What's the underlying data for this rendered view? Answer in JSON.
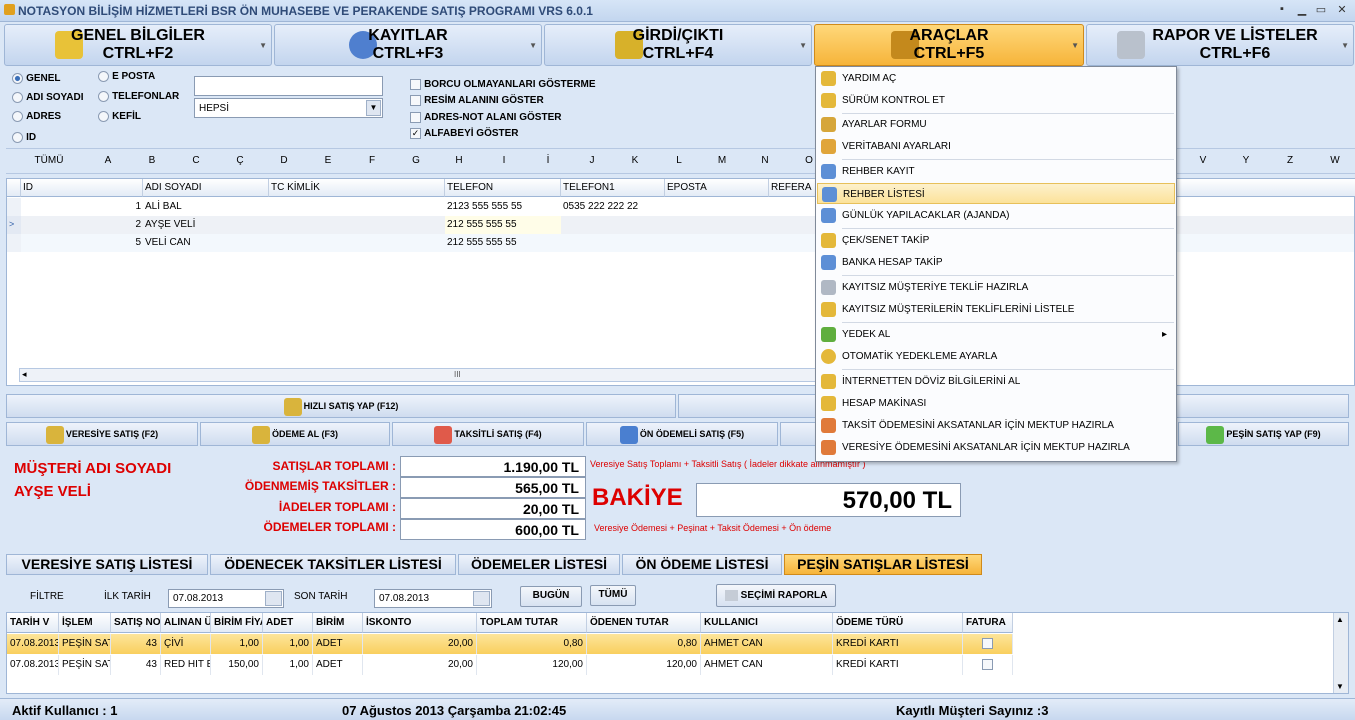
{
  "title": "NOTASYON BİLİŞİM HİZMETLERİ BSR ÖN MUHASEBE VE PERAKENDE SATIŞ PROGRAMI VRS 6.0.1",
  "window_buttons": [
    "▪",
    "▁",
    "▭",
    "✕"
  ],
  "top_menu": [
    {
      "line1": "GENEL BİLGİLER",
      "line2": "CTRL+F2",
      "icon": "notebook-icon"
    },
    {
      "line1": "KAYITLAR",
      "line2": "CTRL+F3",
      "icon": "users-icon"
    },
    {
      "line1": "GİRDİ/ÇIKTI",
      "line2": "CTRL+F4",
      "icon": "money-icon"
    },
    {
      "line1": "ARAÇLAR",
      "line2": "CTRL+F5",
      "icon": "truck-icon"
    },
    {
      "line1": "RAPOR VE LİSTELER",
      "line2": "CTRL+F6",
      "icon": "printer-icon"
    }
  ],
  "search": {
    "radios": [
      "GENEL",
      "ADI SOYADI",
      "ADRES",
      "ID",
      "E POSTA",
      "TELEFONLAR",
      "KEFİL"
    ],
    "text_value": "",
    "combo_value": "HEPSİ",
    "checks": [
      {
        "label": "BORCU OLMAYANLARI GÖSTERME",
        "checked": false
      },
      {
        "label": "RESİM ALANINI GÖSTER",
        "checked": false
      },
      {
        "label": "ADRES-NOT ALANI GÖSTER",
        "checked": false
      },
      {
        "label": "ALFABEYİ GÖSTER",
        "checked": true
      }
    ]
  },
  "alphabet": [
    "TÜMÜ",
    "A",
    "B",
    "C",
    "Ç",
    "D",
    "E",
    "F",
    "G",
    "H",
    "I",
    "İ",
    "J",
    "K",
    "L",
    "M",
    "N",
    "O",
    "V",
    "Y",
    "Z",
    "W"
  ],
  "customers": {
    "columns": [
      "ID",
      "ADI SOYADI",
      "TC KİMLİK",
      "TELEFON",
      "TELEFON1",
      "EPOSTA",
      "REFERA"
    ],
    "rows": [
      {
        "id": "1",
        "name": "ALİ BAL",
        "tc": "",
        "tel": "2123 555 555 55",
        "tel1": "0535 222 222 22",
        "mail": ""
      },
      {
        "id": "2",
        "name": "AYŞE VELİ",
        "tc": "",
        "tel": "212 555 555 55",
        "tel1": "",
        "mail": ""
      },
      {
        "id": "5",
        "name": "VELİ CAN",
        "tc": "",
        "tel": "212 555 555 55",
        "tel1": "",
        "mail": ""
      }
    ],
    "scroll_mark": "III"
  },
  "quick_sale": "HIZLI SATIŞ YAP  (F12)",
  "sale_buttons": [
    "VERESİYE SATIŞ  (F2)",
    "ÖDEME AL  (F3)",
    "TAKSİTLİ SATIŞ  (F4)",
    "ÖN ÖDEMELİ SATIŞ  (F5)",
    "PEŞİN SATIŞ YAP  (F9)"
  ],
  "customer": {
    "label": "MÜŞTERİ ADI SOYADI",
    "name": "AYŞE VELİ"
  },
  "totals": [
    {
      "label": "SATIŞLAR TOPLAMI :",
      "value": "1.190,00 TL"
    },
    {
      "label": "ÖDENMEMİŞ TAKSİTLER :",
      "value": "565,00 TL"
    },
    {
      "label": "İADELER TOPLAMI :",
      "value": "20,00 TL"
    },
    {
      "label": "ÖDEMELER TOPLAMI :",
      "value": "600,00 TL"
    }
  ],
  "note1": "Veresiye Satış Toplamı + Taksitli Satış ( İadeler dikkate alınmamıştır )",
  "note2": "Veresiye Ödemesi + Peşinat + Taksit Ödemesi + Ön ödeme",
  "balance": {
    "label": "BAKİYE",
    "value": "570,00 TL"
  },
  "list_tabs": [
    "VERESİYE SATIŞ LİSTESİ",
    "ÖDENECEK TAKSİTLER LİSTESİ",
    "ÖDEMELER LİSTESİ",
    "ÖN ÖDEME LİSTESİ",
    "PEŞİN SATIŞLAR LİSTESİ"
  ],
  "filter": {
    "label": "FİLTRE",
    "start_label": "İLK TARİH",
    "start": "07.08.2013",
    "end_label": "SON TARİH",
    "end": "07.08.2013",
    "today": "BUGÜN",
    "all": "TÜMÜ",
    "report": "SEÇİMİ RAPORLA"
  },
  "sales": {
    "columns": [
      "TARİH V",
      "İŞLEM",
      "SATIŞ NO",
      "ALINAN Ü",
      "BİRİM FİYAT",
      "ADET",
      "BİRİM",
      "İSKONTO",
      "TOPLAM TUTAR",
      "ÖDENEN TUTAR",
      "KULLANICI",
      "ÖDEME TÜRÜ",
      "FATURA"
    ],
    "rows": [
      [
        "07.08.2013",
        "PEŞİN SATIŞ",
        "43",
        "ÇİVİ",
        "1,00",
        "1,00",
        "ADET",
        "20,00",
        "0,80",
        "0,80",
        "AHMET CAN",
        "KREDİ KARTI"
      ],
      [
        "07.08.2013",
        "PEŞİN SATIŞ",
        "43",
        "RED HIT ENERJİ",
        "150,00",
        "1,00",
        "ADET",
        "20,00",
        "120,00",
        "120,00",
        "AHMET CAN",
        "KREDİ KARTI"
      ]
    ]
  },
  "status": {
    "user": "Aktif Kullanıcı :  1",
    "datetime": "07 Ağustos 2013 Çarşamba 21:02:45",
    "count": "Kayıtlı Müşteri Sayınız :3"
  },
  "tools_menu": [
    {
      "label": "YARDIM AÇ",
      "icon": "help-icon"
    },
    {
      "label": "SÜRÜM KONTROL ET",
      "icon": "update-icon"
    },
    {
      "label": "AYARLAR FORMU",
      "icon": "pen-icon"
    },
    {
      "label": "VERİTABANI AYARLARI",
      "icon": "database-icon"
    },
    {
      "label": "REHBER KAYIT",
      "icon": "contact-icon"
    },
    {
      "label": "REHBER LİSTESİ",
      "icon": "contact-list-icon"
    },
    {
      "label": "GÜNLÜK YAPILACAKLAR (AJANDA)",
      "icon": "calendar-icon"
    },
    {
      "label": "ÇEK/SENET TAKİP",
      "icon": "check-icon"
    },
    {
      "label": "BANKA HESAP TAKİP",
      "icon": "bank-icon"
    },
    {
      "label": "KAYITSIZ MÜŞTERİYE TEKLİF HAZIRLA",
      "icon": "offer-icon"
    },
    {
      "label": "KAYITSIZ MÜŞTERİLERİN TEKLİFLERİNİ LİSTELE",
      "icon": "offer-list-icon"
    },
    {
      "label": "YEDEK AL",
      "icon": "backup-icon"
    },
    {
      "label": "OTOMATİK YEDEKLEME AYARLA",
      "icon": "gear-icon"
    },
    {
      "label": "İNTERNETTEN DÖVİZ BİLGİLERİNİ AL",
      "icon": "currency-icon"
    },
    {
      "label": "HESAP MAKİNASI",
      "icon": "calculator-icon"
    },
    {
      "label": "TAKSİT ÖDEMESİNİ AKSATANLAR İÇİN MEKTUP HAZIRLA",
      "icon": "letter-icon"
    },
    {
      "label": "VERESİYE ÖDEMESİNİ AKSATANLAR İÇİN MEKTUP HAZIRLA",
      "icon": "letter-icon"
    }
  ],
  "submenu_arrow": "▸",
  "colors": {
    "accent": "#f6b43a",
    "danger": "#dd0000",
    "selected_row": "#fbd970"
  }
}
